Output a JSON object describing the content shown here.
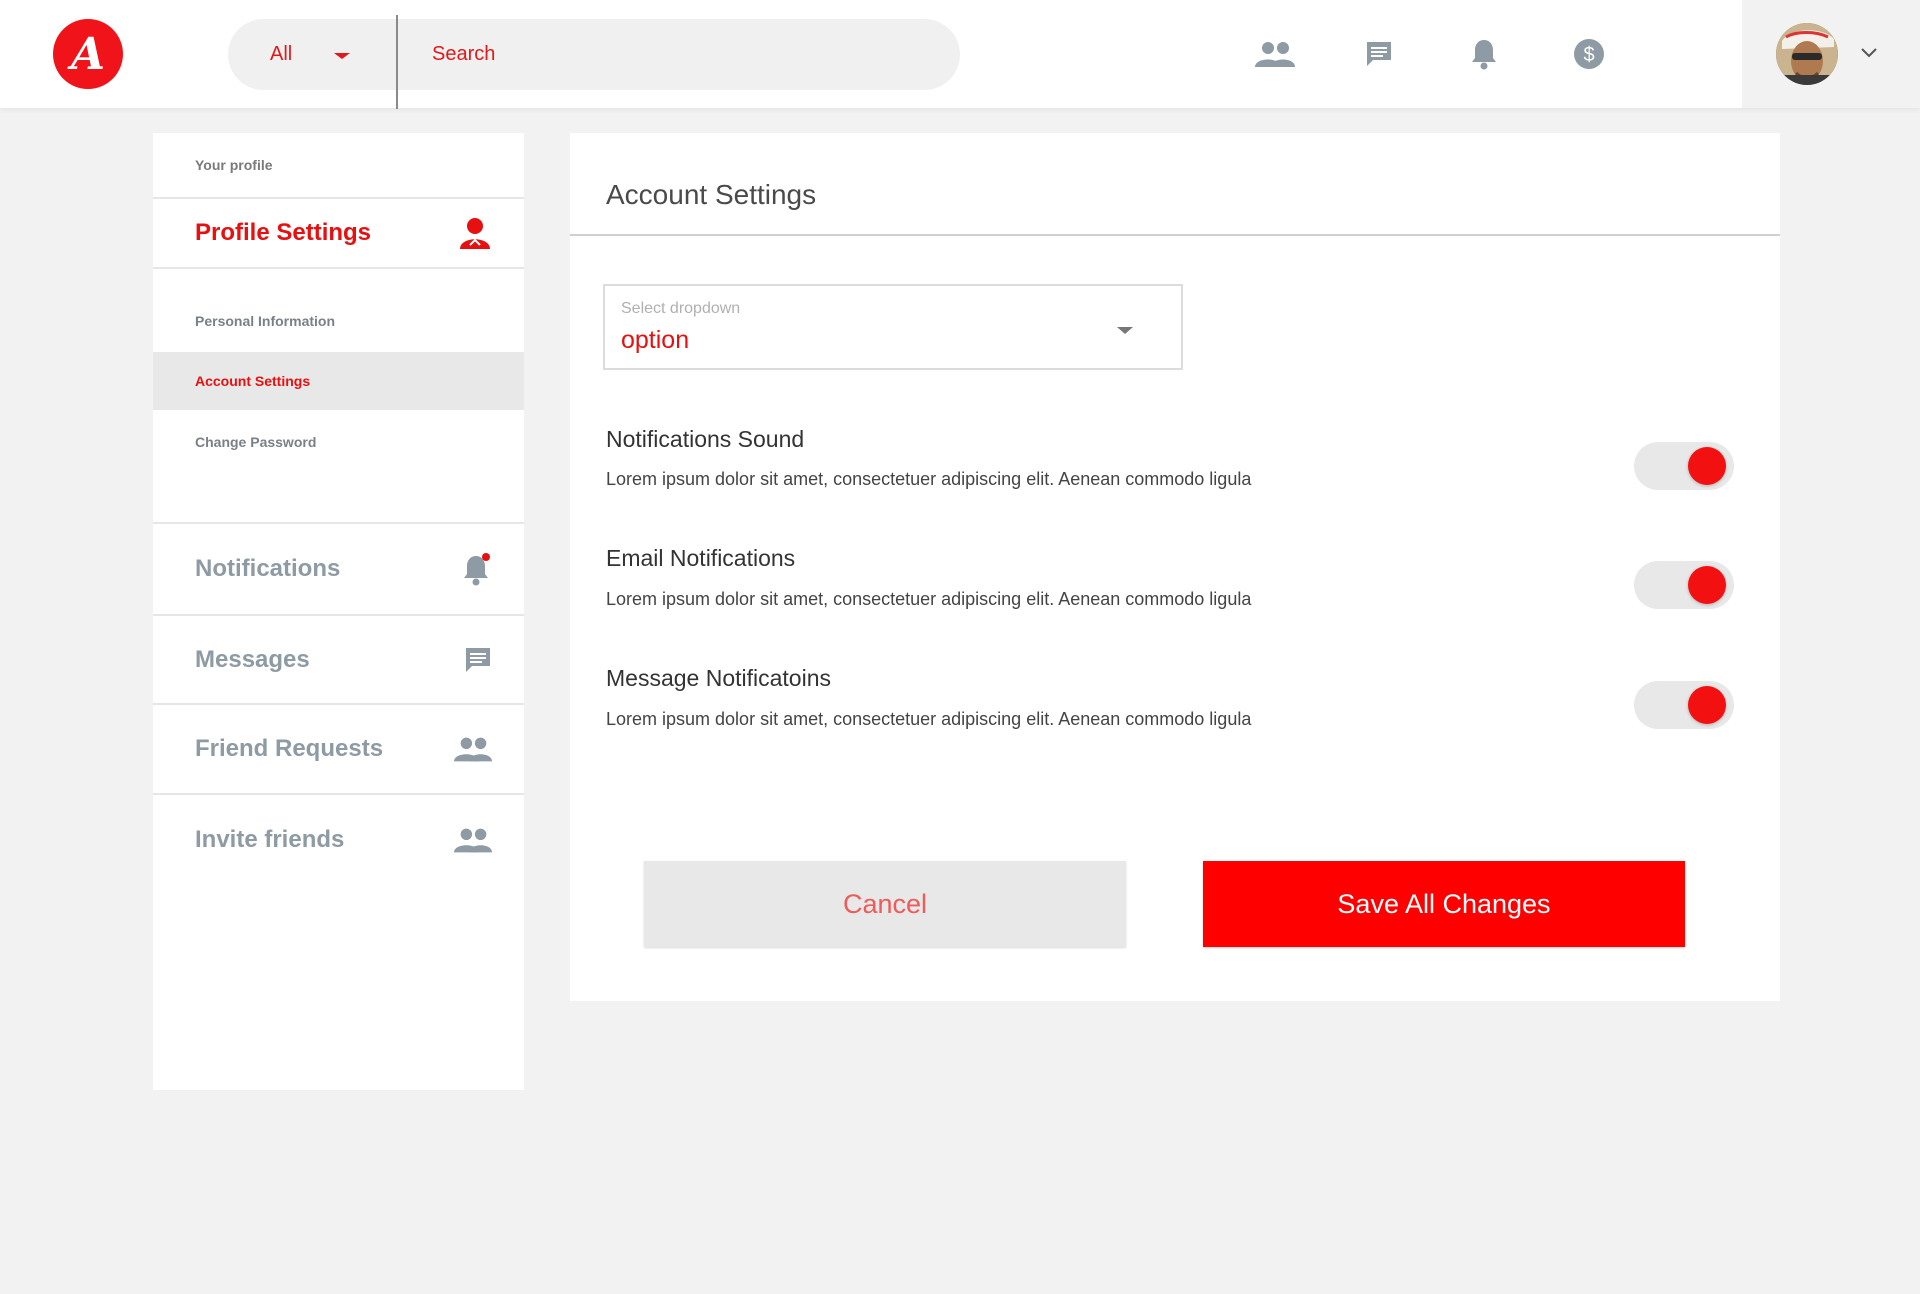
{
  "header": {
    "logo_letter": "A",
    "search": {
      "category": "All",
      "placeholder": "Search"
    },
    "icons": [
      "friends-icon",
      "messages-icon",
      "bell-icon",
      "dollar-icon"
    ]
  },
  "sidebar": {
    "top_label": "Your profile",
    "profile_settings": {
      "title": "Profile Settings",
      "items": [
        {
          "label": "Personal Information"
        },
        {
          "label": "Account Settings"
        },
        {
          "label": "Change Password"
        }
      ]
    },
    "sections": [
      {
        "label": "Notifications",
        "icon": "bell-icon"
      },
      {
        "label": "Messages",
        "icon": "message-icon"
      },
      {
        "label": "Friend Requests",
        "icon": "people-icon"
      },
      {
        "label": "Invite friends",
        "icon": "people-icon"
      }
    ]
  },
  "main": {
    "title": "Account Settings",
    "dropdown": {
      "label": "Select dropdown",
      "value": "option"
    },
    "settings": [
      {
        "title": "Notifications Sound",
        "desc": "Lorem ipsum dolor sit amet, consectetuer adipiscing elit. Aenean commodo ligula",
        "enabled": true
      },
      {
        "title": "Email Notifications",
        "desc": "Lorem ipsum dolor sit amet, consectetuer adipiscing elit. Aenean commodo ligula",
        "enabled": true
      },
      {
        "title": "Message Notificatoins",
        "desc": "Lorem ipsum dolor sit amet, consectetuer adipiscing elit. Aenean commodo ligula",
        "enabled": true
      }
    ],
    "cancel_label": "Cancel",
    "save_label": "Save All Changes"
  },
  "colors": {
    "accent": "#ff0000",
    "icon_gray": "#8e9aa4"
  }
}
